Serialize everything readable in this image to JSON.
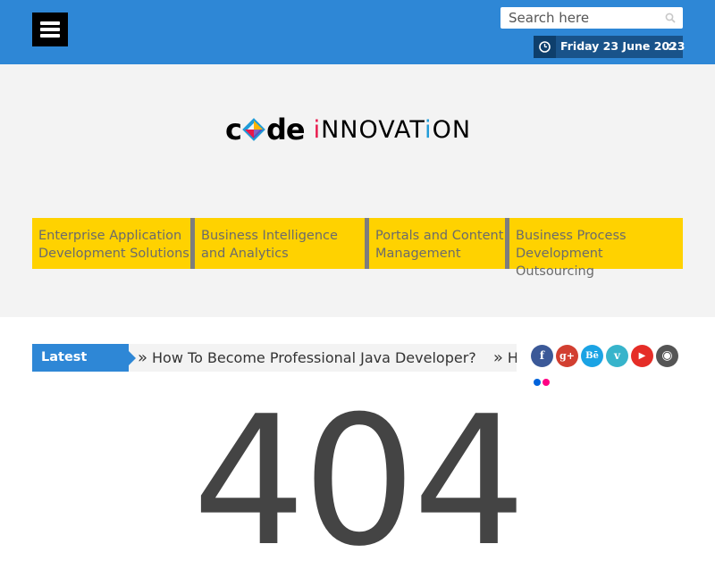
{
  "topbar": {
    "search_placeholder": "Search here",
    "date": "Friday 23 June 2023",
    "date_suffix": "::"
  },
  "logo": {
    "code_c": "c",
    "code_rest": "de",
    "innov_parts": [
      "i",
      "NNOVAT",
      "i",
      "ON"
    ]
  },
  "services": [
    {
      "label": "Enterprise Application Development Solutions"
    },
    {
      "label": "Business Intelligence and Analytics"
    },
    {
      "label": "Portals and Content Management"
    },
    {
      "label": "Business Process Development Outsourcing"
    }
  ],
  "ticker": {
    "label": "Latest Update",
    "items": [
      "How To Become Professional Java Developer?",
      "How To Become Professional Java Developer?"
    ]
  },
  "social": [
    {
      "name": "facebook",
      "glyph": "f",
      "color": "#3b5998"
    },
    {
      "name": "google-plus",
      "glyph": "g+",
      "color": "#d23f31"
    },
    {
      "name": "behance",
      "glyph": "Bē",
      "color": "#1ba3e4"
    },
    {
      "name": "vimeo",
      "glyph": "v",
      "color": "#37b4cb"
    },
    {
      "name": "youtube",
      "glyph": "▶",
      "color": "#e52d27"
    },
    {
      "name": "instagram",
      "glyph": "◉",
      "color": "#555555"
    }
  ],
  "flickr": {
    "colors": [
      "#0063dc",
      "#ff0084"
    ]
  },
  "error": {
    "code": "404"
  },
  "colors": {
    "topbar": "#2e87d6",
    "date_box": "#19538a",
    "header_bg": "#f3f3f3",
    "service_bg": "#ffd200"
  }
}
